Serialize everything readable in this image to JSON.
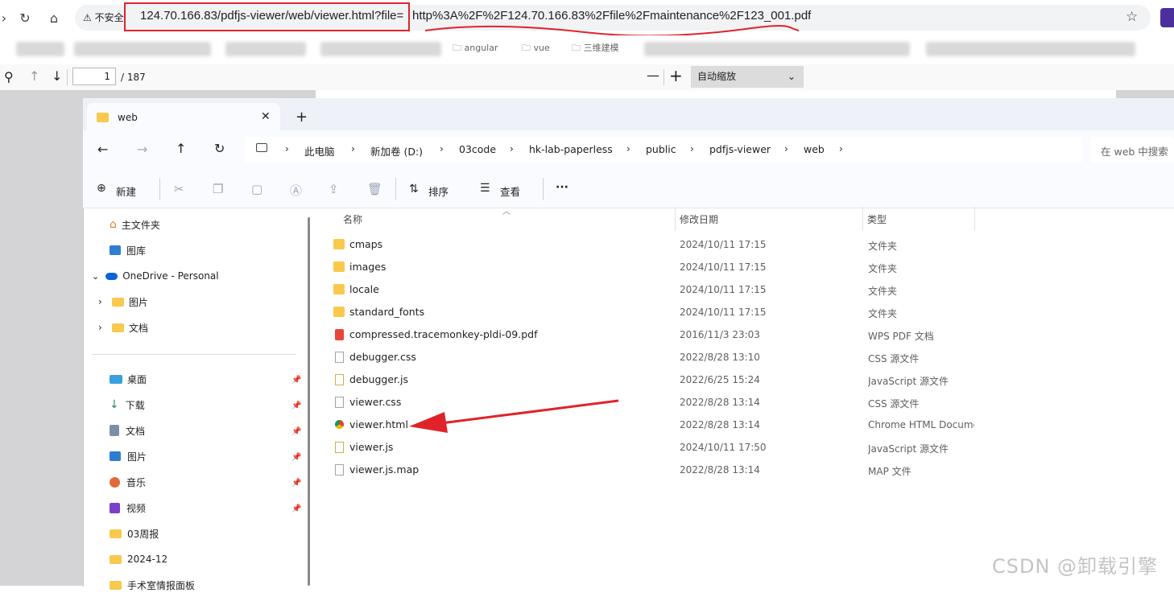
{
  "browser": {
    "security_label": "不安全",
    "url_host_path": "124.70.166.83/pdfjs-viewer/web/viewer.html?file=",
    "url_param": "http%3A%2F%2F124.70.166.83%2Ffile%2Fmaintenance%2F123_001.pdf",
    "bookmarks": [
      "angular",
      "vue",
      "三维建模"
    ]
  },
  "pdf_viewer": {
    "page_number": "1",
    "page_count": "/ 187",
    "zoom_label": "自动缩放",
    "zoom_out": "—",
    "zoom_in": "+"
  },
  "explorer": {
    "tab_title": "web",
    "new_tab": "+",
    "breadcrumb": [
      "此电脑",
      "新加卷 (D:)",
      "03code",
      "hk-lab-paperless",
      "public",
      "pdfjs-viewer",
      "web"
    ],
    "search_placeholder": "在 web 中搜索",
    "commands": {
      "new": "新建",
      "sort": "排序",
      "view": "查看",
      "more": "···"
    },
    "nav": {
      "home": "主文件夹",
      "gallery": "图库",
      "onedrive": "OneDrive - Personal",
      "od_pictures": "图片",
      "od_documents": "文档",
      "desktop": "桌面",
      "downloads": "下载",
      "documents": "文档",
      "pictures": "图片",
      "music": "音乐",
      "videos": "视频",
      "weekly": "03周报",
      "dec2024": "2024-12",
      "partial": "手术室情报面板"
    },
    "columns": {
      "name": "名称",
      "date": "修改日期",
      "type": "类型"
    },
    "files": [
      {
        "name": "cmaps",
        "date": "2024/10/11 17:15",
        "type": "文件夹",
        "icon": "folder-icon"
      },
      {
        "name": "images",
        "date": "2024/10/11 17:15",
        "type": "文件夹",
        "icon": "folder-icon"
      },
      {
        "name": "locale",
        "date": "2024/10/11 17:15",
        "type": "文件夹",
        "icon": "folder-icon"
      },
      {
        "name": "standard_fonts",
        "date": "2024/10/11 17:15",
        "type": "文件夹",
        "icon": "folder-icon"
      },
      {
        "name": "compressed.tracemonkey-pldi-09.pdf",
        "date": "2016/11/3 23:03",
        "type": "WPS PDF 文档",
        "icon": "pdf-file-icon"
      },
      {
        "name": "debugger.css",
        "date": "2022/8/28 13:10",
        "type": "CSS 源文件",
        "icon": "css-file-icon"
      },
      {
        "name": "debugger.js",
        "date": "2022/6/25 15:24",
        "type": "JavaScript 源文件",
        "icon": "js-file-icon"
      },
      {
        "name": "viewer.css",
        "date": "2022/8/28 13:14",
        "type": "CSS 源文件",
        "icon": "css-file-icon"
      },
      {
        "name": "viewer.html",
        "date": "2022/8/28 13:14",
        "type": "Chrome HTML Document",
        "icon": "chrome-html-icon"
      },
      {
        "name": "viewer.js",
        "date": "2024/10/11 17:50",
        "type": "JavaScript 源文件",
        "icon": "js-file-icon"
      },
      {
        "name": "viewer.js.map",
        "date": "2022/8/28 13:14",
        "type": "MAP 文件",
        "icon": "generic-file-icon"
      }
    ]
  },
  "watermark": "CSDN @卸载引擎",
  "colors": {
    "annotation_red": "#e0232a",
    "folder_yellow": "#f9c94d",
    "onedrive_blue": "#0a64d8"
  }
}
